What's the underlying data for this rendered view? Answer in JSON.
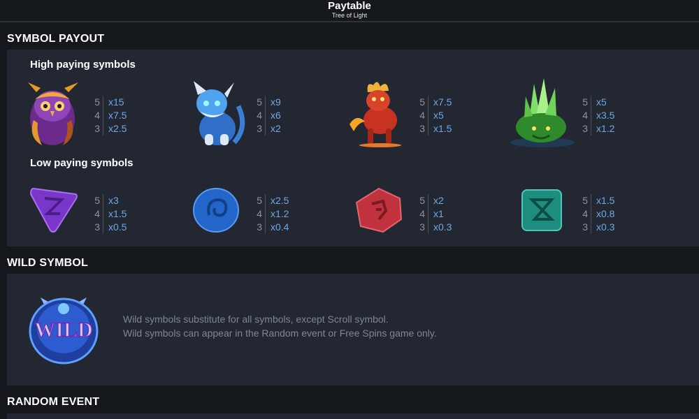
{
  "header": {
    "title": "Paytable",
    "subtitle": "Tree of Light"
  },
  "sections": {
    "symbol_payout": "SYMBOL PAYOUT",
    "wild_symbol": "WILD SYMBOL",
    "random_event": "RANDOM EVENT"
  },
  "groups": {
    "high": "High paying symbols",
    "low": "Low paying symbols"
  },
  "high_symbols": [
    {
      "icon": "purple-owl-icon",
      "pays": [
        {
          "count": "5",
          "value": "x15"
        },
        {
          "count": "4",
          "value": "x7.5"
        },
        {
          "count": "3",
          "value": "x2.5"
        }
      ]
    },
    {
      "icon": "blue-cat-creature-icon",
      "pays": [
        {
          "count": "5",
          "value": "x9"
        },
        {
          "count": "4",
          "value": "x6"
        },
        {
          "count": "3",
          "value": "x2"
        }
      ]
    },
    {
      "icon": "red-fire-creature-icon",
      "pays": [
        {
          "count": "5",
          "value": "x7.5"
        },
        {
          "count": "4",
          "value": "x5"
        },
        {
          "count": "3",
          "value": "x1.5"
        }
      ]
    },
    {
      "icon": "green-crystal-toad-icon",
      "pays": [
        {
          "count": "5",
          "value": "x5"
        },
        {
          "count": "4",
          "value": "x3.5"
        },
        {
          "count": "3",
          "value": "x1.2"
        }
      ]
    }
  ],
  "low_symbols": [
    {
      "icon": "purple-triangle-rune-icon",
      "pays": [
        {
          "count": "5",
          "value": "x3"
        },
        {
          "count": "4",
          "value": "x1.5"
        },
        {
          "count": "3",
          "value": "x0.5"
        }
      ]
    },
    {
      "icon": "blue-circle-rune-icon",
      "pays": [
        {
          "count": "5",
          "value": "x2.5"
        },
        {
          "count": "4",
          "value": "x1.2"
        },
        {
          "count": "3",
          "value": "x0.4"
        }
      ]
    },
    {
      "icon": "red-hexagon-rune-icon",
      "pays": [
        {
          "count": "5",
          "value": "x2"
        },
        {
          "count": "4",
          "value": "x1"
        },
        {
          "count": "3",
          "value": "x0.3"
        }
      ]
    },
    {
      "icon": "teal-square-rune-icon",
      "pays": [
        {
          "count": "5",
          "value": "x1.5"
        },
        {
          "count": "4",
          "value": "x0.8"
        },
        {
          "count": "3",
          "value": "x0.3"
        }
      ]
    }
  ],
  "wild": {
    "icon": "wild-badge-icon",
    "badge_text": "WILD",
    "line1": "Wild symbols substitute for all symbols, except Scroll symbol.",
    "line2": "Wild symbols can appear in the Random event or Free Spins game only."
  },
  "colors": {
    "background": "#14171c",
    "panel": "#222731",
    "payout_value": "#6ea8e6",
    "count": "#8d939c"
  }
}
